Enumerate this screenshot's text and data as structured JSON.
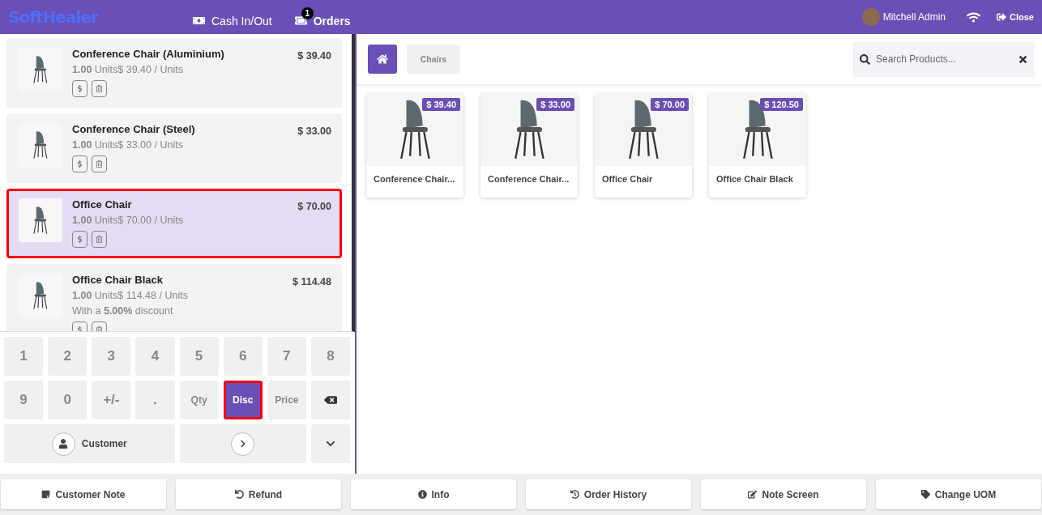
{
  "header": {
    "logo": "SoftHealer",
    "nav": [
      {
        "label": "Cash In/Out",
        "kind": "cash"
      },
      {
        "label": "Orders",
        "kind": "orders",
        "badge": "1"
      }
    ],
    "user": "Mitchell Admin",
    "close": "Close"
  },
  "order_lines": [
    {
      "name": "Conference Chair (Aluminium)",
      "price": "$ 39.40",
      "quantity": "**1.00** Units$ 39.40 / Units",
      "selected": false
    },
    {
      "name": "Conference Chair (Steel)",
      "price": "$ 33.00",
      "quantity": "**1.00** Units$ 33.00 / Units",
      "selected": false
    },
    {
      "name": "Office Chair",
      "price": "$ 70.00",
      "quantity": "**1.00** Units$ 70.00 / Units",
      "selected": true
    },
    {
      "name": "Office Chair Black",
      "price": "$ 114.48",
      "quantity": "**1.00** Units$ 114.48 / Units",
      "discount": "With a **5.00%** discount",
      "selected": false
    }
  ],
  "numpad": [
    {
      "kind": "digit",
      "label": "1"
    },
    {
      "kind": "digit",
      "label": "2"
    },
    {
      "kind": "digit",
      "label": "3"
    },
    {
      "kind": "digit",
      "label": "4"
    },
    {
      "kind": "digit",
      "label": "5"
    },
    {
      "kind": "digit",
      "label": "6"
    },
    {
      "kind": "digit",
      "label": "7"
    },
    {
      "kind": "digit",
      "label": "8"
    },
    {
      "kind": "digit",
      "label": "9"
    },
    {
      "kind": "digit",
      "label": "0"
    },
    {
      "kind": "digit",
      "label": "+/-"
    },
    {
      "kind": "digit",
      "label": "."
    },
    {
      "kind": "mode",
      "label": "Qty",
      "selected": false
    },
    {
      "kind": "mode",
      "label": "Disc",
      "selected": true
    },
    {
      "kind": "mode",
      "label": "Price",
      "selected": false
    },
    {
      "kind": "backspace"
    }
  ],
  "customer_button": "Customer",
  "categories": [
    {
      "label": "Chairs"
    }
  ],
  "search": {
    "placeholder": "Search Products..."
  },
  "products": [
    {
      "name": "Conference Chair...",
      "price": "$ 39.40"
    },
    {
      "name": "Conference Chair...",
      "price": "$ 33.00"
    },
    {
      "name": "Office Chair",
      "price": "$ 70.00"
    },
    {
      "name": "Office Chair Black",
      "price": "$ 120.50"
    }
  ],
  "actions": [
    {
      "label": "Customer Note",
      "kind": "note"
    },
    {
      "label": "Refund",
      "kind": "refund"
    },
    {
      "label": "Info",
      "kind": "info"
    },
    {
      "label": "Order History",
      "kind": "history"
    },
    {
      "label": "Note Screen",
      "kind": "edit"
    },
    {
      "label": "Change UOM",
      "kind": "tag"
    }
  ]
}
